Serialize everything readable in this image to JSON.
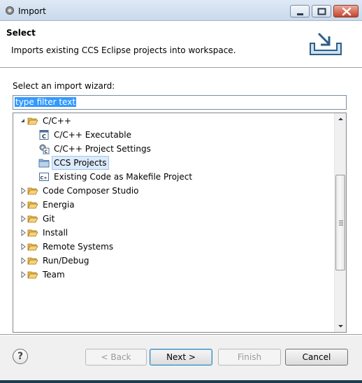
{
  "window": {
    "title": "Import"
  },
  "header": {
    "title": "Select",
    "description": "Imports existing CCS Eclipse projects into workspace."
  },
  "wizard": {
    "label": "Select an import wizard:",
    "filter_value": "type filter text"
  },
  "tree": {
    "root": {
      "label": "C/C++"
    },
    "children": [
      {
        "label": "C/C++ Executable",
        "icon": "cpp-executable-icon"
      },
      {
        "label": "C/C++ Project Settings",
        "icon": "project-settings-icon"
      },
      {
        "label": "CCS Projects",
        "icon": "folder-icon",
        "selected": true
      },
      {
        "label": "Existing Code as Makefile Project",
        "icon": "makefile-project-icon"
      }
    ],
    "folders": [
      "Code Composer Studio",
      "Energia",
      "Git",
      "Install",
      "Remote Systems",
      "Run/Debug",
      "Team"
    ]
  },
  "buttons": {
    "help": "?",
    "back": "< Back",
    "next": "Next >",
    "finish": "Finish",
    "cancel": "Cancel"
  }
}
